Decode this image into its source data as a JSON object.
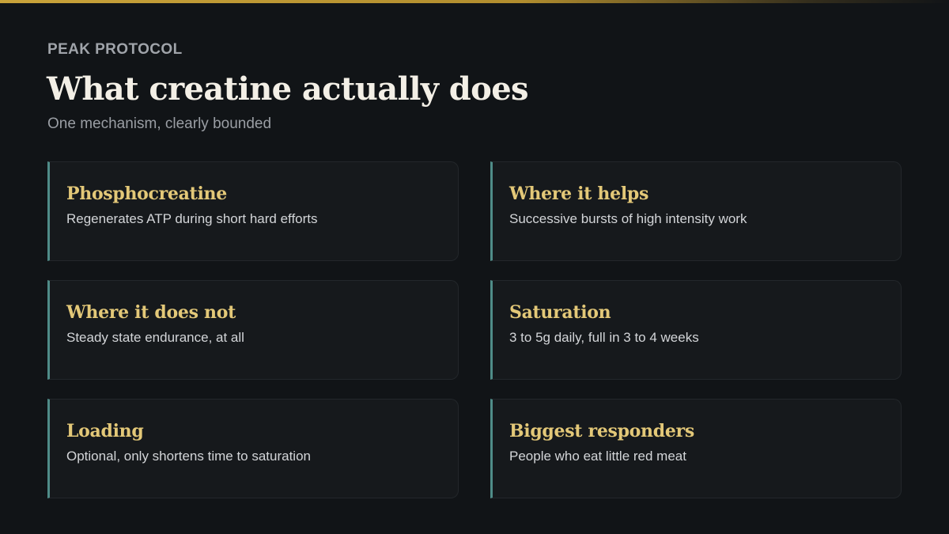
{
  "header": {
    "eyebrow": "PEAK PROTOCOL",
    "title": "What creatine actually does",
    "subtitle": "One mechanism, clearly bounded"
  },
  "cards": [
    {
      "title": "Phosphocreatine",
      "description": "Regenerates ATP during short hard efforts"
    },
    {
      "title": "Where it helps",
      "description": "Successive bursts of high intensity work"
    },
    {
      "title": "Where it does not",
      "description": "Steady state endurance, at all"
    },
    {
      "title": "Saturation",
      "description": "3 to 5g daily, full in 3 to 4 weeks"
    },
    {
      "title": "Loading",
      "description": "Optional, only shortens time to saturation"
    },
    {
      "title": "Biggest responders",
      "description": "People who eat little red meat"
    }
  ],
  "colors": {
    "background": "#111417",
    "accent_gold": "#c9a33a",
    "card_title": "#e3c878",
    "card_border_accent": "#4f8c88"
  }
}
